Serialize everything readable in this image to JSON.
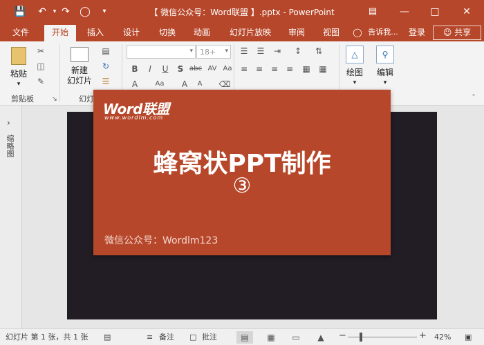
{
  "window": {
    "title": "【 微信公众号：Word联盟 】.pptx - PowerPoint",
    "colors": {
      "accent": "#b7472a",
      "slide_bg": "#221c24"
    }
  },
  "quick_access": {
    "save_icon": "save-icon",
    "undo_icon": "undo-icon",
    "redo_icon": "redo-icon",
    "present_icon": "present-from-start-icon",
    "customize_icon": "customize-quick-access-icon"
  },
  "tabs": [
    "文件",
    "开始",
    "插入",
    "设计",
    "切换",
    "动画",
    "幻灯片放映",
    "审阅",
    "视图"
  ],
  "active_tab": "开始",
  "tell_me": "告诉我...",
  "login": "登录",
  "share": "共享",
  "ribbon": {
    "paste": "粘贴",
    "new_slide_line1": "新建",
    "new_slide_line2": "幻灯片",
    "clipboard_label": "剪贴板",
    "slides_label": "幻灯",
    "font_size": "18+",
    "drawing": "绘图",
    "editing": "编辑"
  },
  "left_pane": {
    "label": "缩略图"
  },
  "popup": {
    "logo": "Word联盟",
    "logo_sub": "www.wordlm.com",
    "headline": "蜂窝状PPT制作",
    "number": "③",
    "footer": "微信公众号：Wordlm123"
  },
  "status": {
    "slide_info": "幻灯片 第 1 张，共 1 张",
    "notes": "备注",
    "comments": "批注",
    "zoom": "42%"
  }
}
